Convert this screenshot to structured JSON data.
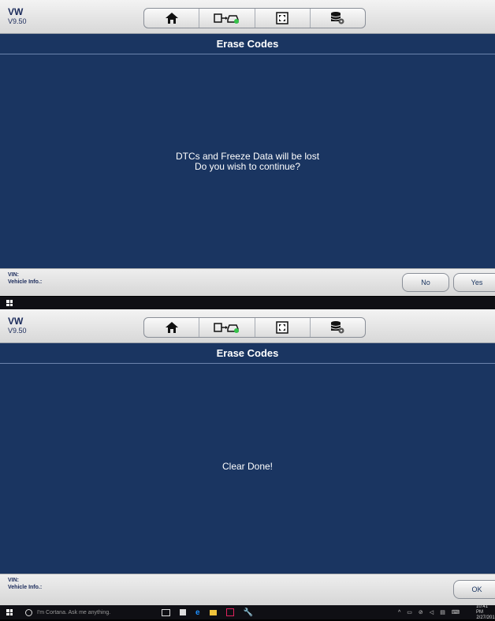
{
  "top": {
    "make": "VW",
    "version": "V9.50",
    "title": "Erase Codes",
    "message_line1": "DTCs and Freeze Data will be lost",
    "message_line2": "Do you wish to continue?",
    "vin_label": "VIN:",
    "vehicle_label": "Vehicle Info.:",
    "no_label": "No",
    "yes_label": "Yes"
  },
  "bottom": {
    "make": "VW",
    "version": "V9.50",
    "title": "Erase Codes",
    "message": "Clear Done!",
    "vin_label": "VIN:",
    "vehicle_label": "Vehicle Info.:",
    "ok_label": "OK"
  },
  "toolbar_icons": [
    "home-icon",
    "vehicle-connect-icon",
    "fullscreen-icon",
    "data-settings-icon"
  ],
  "taskbar": {
    "search_placeholder": "I'm Cortana. Ask me anything.",
    "time": "10:41 PM",
    "date": "2/27/201"
  },
  "colors": {
    "navy": "#1a3561",
    "accent_green": "#35c24a"
  }
}
